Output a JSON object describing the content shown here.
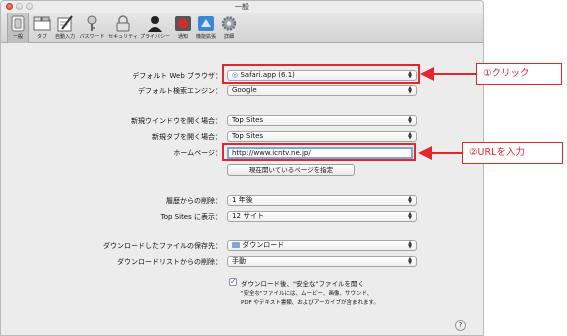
{
  "window": {
    "title": "一般"
  },
  "toolbar": {
    "items": [
      {
        "label": "一般"
      },
      {
        "label": "タブ"
      },
      {
        "label": "自動入力"
      },
      {
        "label": "パスワード"
      },
      {
        "label": "セキュリティ"
      },
      {
        "label": "プライバシー"
      },
      {
        "label": "通知"
      },
      {
        "label": "機能拡張"
      },
      {
        "label": "詳細"
      }
    ]
  },
  "settings": {
    "default_browser": {
      "label": "デフォルト Web ブラウザ：",
      "value": "Safari.app (6.1)"
    },
    "default_search": {
      "label": "デフォルト検索エンジン：",
      "value": "Google"
    },
    "new_window": {
      "label": "新規ウインドウを開く場合：",
      "value": "Top Sites"
    },
    "new_tab": {
      "label": "新規タブを開く場合：",
      "value": "Top Sites"
    },
    "homepage": {
      "label": "ホームページ：",
      "value": "http://www.icntv.ne.jp/",
      "button": "現在開いているページを指定"
    },
    "history_removal": {
      "label": "履歴からの削除：",
      "value": "1 年後"
    },
    "top_sites_show": {
      "label": "Top Sites に表示：",
      "value": "12 サイト"
    },
    "download_location": {
      "label": "ダウンロードしたファイルの保存先：",
      "value": "ダウンロード"
    },
    "download_list_removal": {
      "label": "ダウンロードリストからの削除：",
      "value": "手動"
    },
    "open_safe_files": {
      "label": "ダウンロード後、\"安全な\"ファイルを開く",
      "note_line1": "\"安全な\"ファイルには、ムービー、画像、サウンド、",
      "note_line2": "PDF やテキスト書類、およびアーカイブが含まれます。",
      "checked": true
    }
  },
  "annotations": {
    "step1": "①クリック",
    "step2": "②URLを入力"
  },
  "colors": {
    "annotation_red": "#e3262f",
    "focus_blue": "#7fa7dc"
  },
  "help_symbol": "?"
}
